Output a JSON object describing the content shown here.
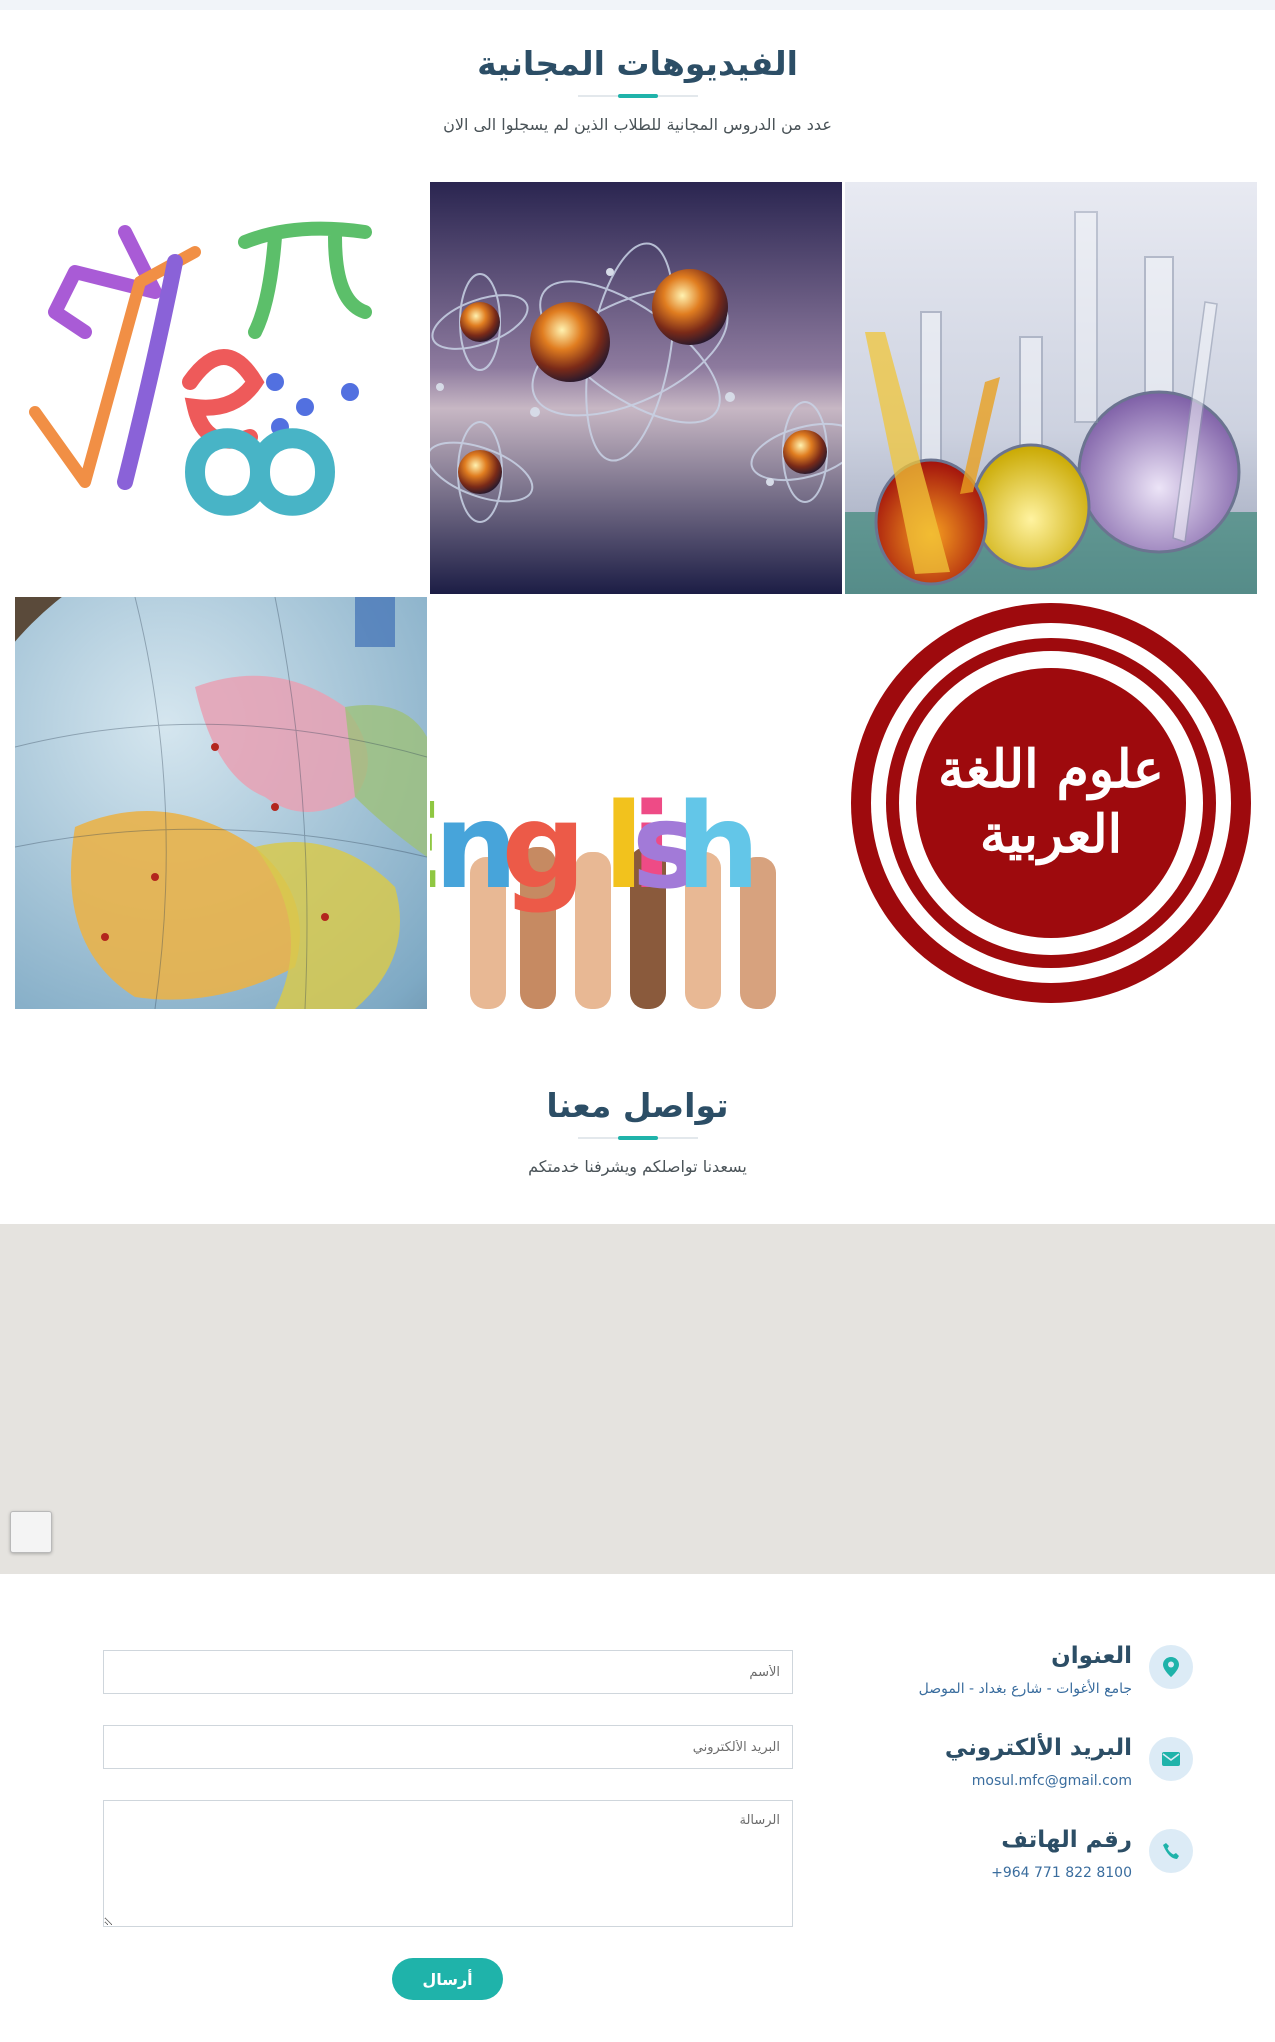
{
  "free_videos": {
    "title": "الفيديوهات المجانية",
    "subtitle": "عدد من الدروس المجانية للطلاب الذين لم يسجلوا الى الان",
    "tiles": [
      {
        "name": "chemistry",
        "icon": "lab-flasks-image"
      },
      {
        "name": "physics",
        "icon": "atoms-image"
      },
      {
        "name": "mathematics",
        "icon": "math-symbols-image"
      },
      {
        "name": "arabic",
        "icon": "arabic-seal-image",
        "caption": "علوم اللغة العربية"
      },
      {
        "name": "english",
        "icon": "english-hands-image",
        "caption": "English"
      },
      {
        "name": "geography",
        "icon": "globe-image"
      }
    ]
  },
  "contact": {
    "title": "تواصل معنا",
    "subtitle": "يسعدنا تواصلكم ويشرفنا خدمتكم",
    "address_title": "العنوان",
    "address_value": "جامع الأغوات - شارع بغداد - الموصل",
    "email_title": "البريد الألكتروني",
    "email_value": "mosul.mfc@gmail.com",
    "phone_title": "رقم الهاتف",
    "phone_value": "+964 771 822 8100",
    "form": {
      "name_placeholder": "الأسم",
      "email_placeholder": "البريد الألكتروني",
      "message_placeholder": "الرسالة",
      "send_label": "أرسال"
    }
  },
  "colors": {
    "accent": "#1fb3aa",
    "heading": "#2c4e66",
    "link": "#3a6d9e",
    "icon_bg": "#dcebf6",
    "map_bg": "#e5e3df"
  }
}
